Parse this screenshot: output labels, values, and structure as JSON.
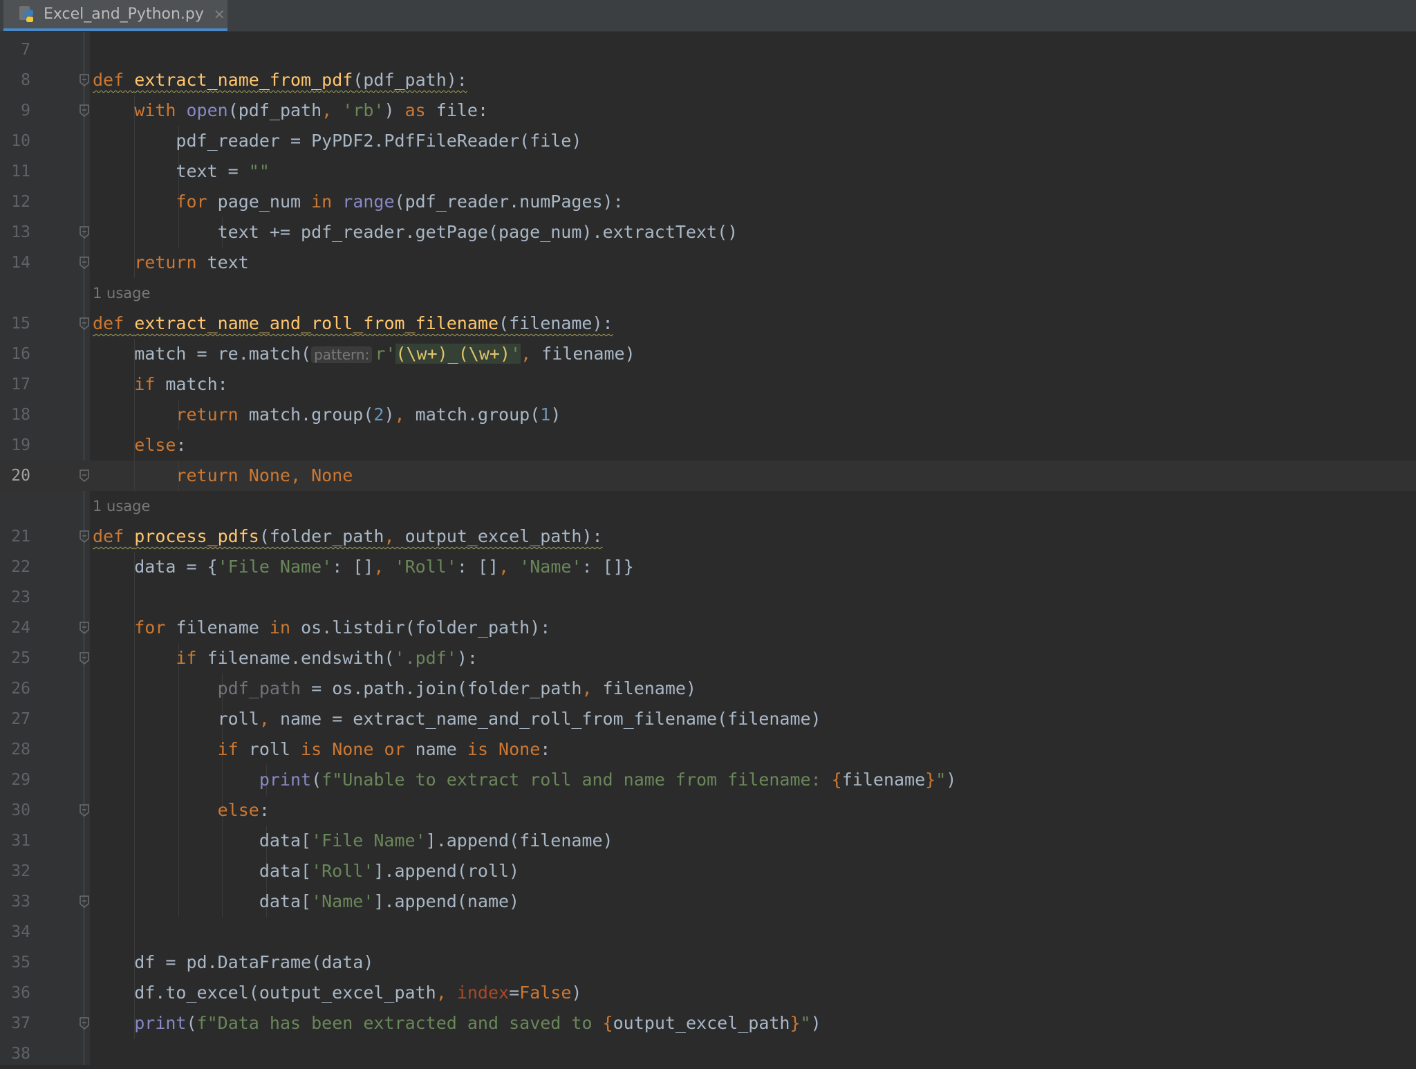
{
  "tab": {
    "title": "Excel_and_Python.py",
    "icon": "python-file-icon",
    "close_icon": "close-icon"
  },
  "current_line": 20,
  "usage_hints": [
    "1 usage",
    "1 usage"
  ],
  "lines": [
    {
      "n": 7,
      "tokens": []
    },
    {
      "n": 8,
      "tokens": [
        [
          "def ",
          "kw wavy"
        ],
        [
          "extract_name_from_pdf",
          "fn wavy"
        ],
        [
          "(pdf_path):",
          "wavy"
        ]
      ]
    },
    {
      "n": 9,
      "tokens": [
        [
          "    "
        ],
        [
          "with ",
          "kw"
        ],
        [
          "open",
          "bi"
        ],
        [
          "(pdf_path"
        ],
        [
          ", ",
          "kw"
        ],
        [
          "'rb'",
          "str"
        ],
        [
          ") "
        ],
        [
          "as ",
          "kw"
        ],
        [
          "file:"
        ]
      ]
    },
    {
      "n": 10,
      "tokens": [
        [
          "        pdf_reader = PyPDF2.PdfFileReader(file)"
        ]
      ]
    },
    {
      "n": 11,
      "tokens": [
        [
          "        text = "
        ],
        [
          "\"\"",
          "str"
        ]
      ]
    },
    {
      "n": 12,
      "tokens": [
        [
          "        "
        ],
        [
          "for ",
          "kw"
        ],
        [
          "page_num "
        ],
        [
          "in ",
          "kw"
        ],
        [
          "range",
          "bi"
        ],
        [
          "(pdf_reader.numPages):"
        ]
      ]
    },
    {
      "n": 13,
      "tokens": [
        [
          "            text += pdf_reader.getPage(page_num).extractText()"
        ]
      ]
    },
    {
      "n": 14,
      "tokens": [
        [
          "    "
        ],
        [
          "return ",
          "kw"
        ],
        [
          "text"
        ]
      ]
    },
    {
      "n": 15,
      "tokens": [
        [
          "def ",
          "kw wavy"
        ],
        [
          "extract_name_and_roll_from_filename",
          "fn wavy"
        ],
        [
          "(filename):",
          "wavy"
        ]
      ]
    },
    {
      "n": 16,
      "tokens": [
        [
          "    match = re.match("
        ],
        [
          "pattern:",
          "hint"
        ],
        [
          "r'",
          "str"
        ],
        [
          "(\\w+)_(\\w+)",
          "rx"
        ],
        [
          "'",
          "rxq"
        ],
        [
          ", ",
          "kw"
        ],
        [
          "filename)"
        ]
      ]
    },
    {
      "n": 17,
      "tokens": [
        [
          "    "
        ],
        [
          "if ",
          "kw"
        ],
        [
          "match:"
        ]
      ]
    },
    {
      "n": 18,
      "tokens": [
        [
          "        "
        ],
        [
          "return ",
          "kw"
        ],
        [
          "match.group("
        ],
        [
          "2",
          "num"
        ],
        [
          ")"
        ],
        [
          ", ",
          "kw"
        ],
        [
          "match.group("
        ],
        [
          "1",
          "num"
        ],
        [
          ")"
        ]
      ]
    },
    {
      "n": 19,
      "tokens": [
        [
          "    "
        ],
        [
          "else",
          "kw"
        ],
        [
          ":"
        ]
      ]
    },
    {
      "n": 20,
      "tokens": [
        [
          "        "
        ],
        [
          "return ",
          "kw"
        ],
        [
          "None",
          "kw"
        ],
        [
          ", ",
          "kw"
        ],
        [
          "None",
          "kw"
        ]
      ]
    },
    {
      "n": 21,
      "tokens": [
        [
          "def ",
          "kw wavy"
        ],
        [
          "process_pdfs",
          "fn wavy"
        ],
        [
          "(folder_path",
          "wavy"
        ],
        [
          ", ",
          "kw wavy"
        ],
        [
          "output_excel_path):",
          "wavy"
        ]
      ]
    },
    {
      "n": 22,
      "tokens": [
        [
          "    data = {"
        ],
        [
          "'File Name'",
          "str"
        ],
        [
          ": []"
        ],
        [
          ", ",
          "kw"
        ],
        [
          "'Roll'",
          "str"
        ],
        [
          ": []"
        ],
        [
          ", ",
          "kw"
        ],
        [
          "'Name'",
          "str"
        ],
        [
          ": []}"
        ]
      ]
    },
    {
      "n": 23,
      "tokens": []
    },
    {
      "n": 24,
      "tokens": [
        [
          "    "
        ],
        [
          "for ",
          "kw"
        ],
        [
          "filename "
        ],
        [
          "in ",
          "kw"
        ],
        [
          "os.listdir(folder_path):"
        ]
      ]
    },
    {
      "n": 25,
      "tokens": [
        [
          "        "
        ],
        [
          "if ",
          "kw"
        ],
        [
          "filename.endswith("
        ],
        [
          "'.pdf'",
          "str"
        ],
        [
          "):"
        ]
      ]
    },
    {
      "n": 26,
      "tokens": [
        [
          "            "
        ],
        [
          "pdf_path",
          "unused"
        ],
        [
          " = os.path.join(folder_path"
        ],
        [
          ", ",
          "kw"
        ],
        [
          "filename)"
        ]
      ]
    },
    {
      "n": 27,
      "tokens": [
        [
          "            roll"
        ],
        [
          ", ",
          "kw"
        ],
        [
          "name = extract_name_and_roll_from_filename(filename)"
        ]
      ]
    },
    {
      "n": 28,
      "tokens": [
        [
          "            "
        ],
        [
          "if ",
          "kw"
        ],
        [
          "roll "
        ],
        [
          "is ",
          "kw"
        ],
        [
          "None ",
          "kw"
        ],
        [
          "or ",
          "kw"
        ],
        [
          "name "
        ],
        [
          "is ",
          "kw"
        ],
        [
          "None",
          "kw"
        ],
        [
          ":"
        ]
      ]
    },
    {
      "n": 29,
      "tokens": [
        [
          "                "
        ],
        [
          "print",
          "bi"
        ],
        [
          "("
        ],
        [
          "f\"Unable to extract roll and name from filename: ",
          "str"
        ],
        [
          "{",
          "kw"
        ],
        [
          "filename"
        ],
        [
          "}",
          "kw"
        ],
        [
          "\"",
          "str"
        ],
        [
          ")"
        ]
      ]
    },
    {
      "n": 30,
      "tokens": [
        [
          "            "
        ],
        [
          "else",
          "kw"
        ],
        [
          ":"
        ]
      ]
    },
    {
      "n": 31,
      "tokens": [
        [
          "                data["
        ],
        [
          "'File Name'",
          "str"
        ],
        [
          "].append(filename)"
        ]
      ]
    },
    {
      "n": 32,
      "tokens": [
        [
          "                data["
        ],
        [
          "'Roll'",
          "str"
        ],
        [
          "].append(roll)"
        ]
      ]
    },
    {
      "n": 33,
      "tokens": [
        [
          "                data["
        ],
        [
          "'Name'",
          "str"
        ],
        [
          "].append(name)"
        ]
      ]
    },
    {
      "n": 34,
      "tokens": []
    },
    {
      "n": 35,
      "tokens": [
        [
          "    df = pd.DataFrame(data)"
        ]
      ]
    },
    {
      "n": 36,
      "tokens": [
        [
          "    df.to_excel(output_excel_path"
        ],
        [
          ", ",
          "kw"
        ],
        [
          "index",
          "param"
        ],
        [
          "="
        ],
        [
          "False",
          "kw"
        ],
        [
          ")"
        ]
      ]
    },
    {
      "n": 37,
      "tokens": [
        [
          "    "
        ],
        [
          "print",
          "bi"
        ],
        [
          "("
        ],
        [
          "f\"Data has been extracted and saved to ",
          "str"
        ],
        [
          "{",
          "kw"
        ],
        [
          "output_excel_path"
        ],
        [
          "}",
          "kw"
        ],
        [
          "\"",
          "str"
        ],
        [
          ")"
        ]
      ]
    },
    {
      "n": 38,
      "tokens": []
    }
  ],
  "folds": [
    8,
    9,
    13,
    14,
    15,
    20,
    21,
    24,
    25,
    30,
    33,
    37
  ]
}
